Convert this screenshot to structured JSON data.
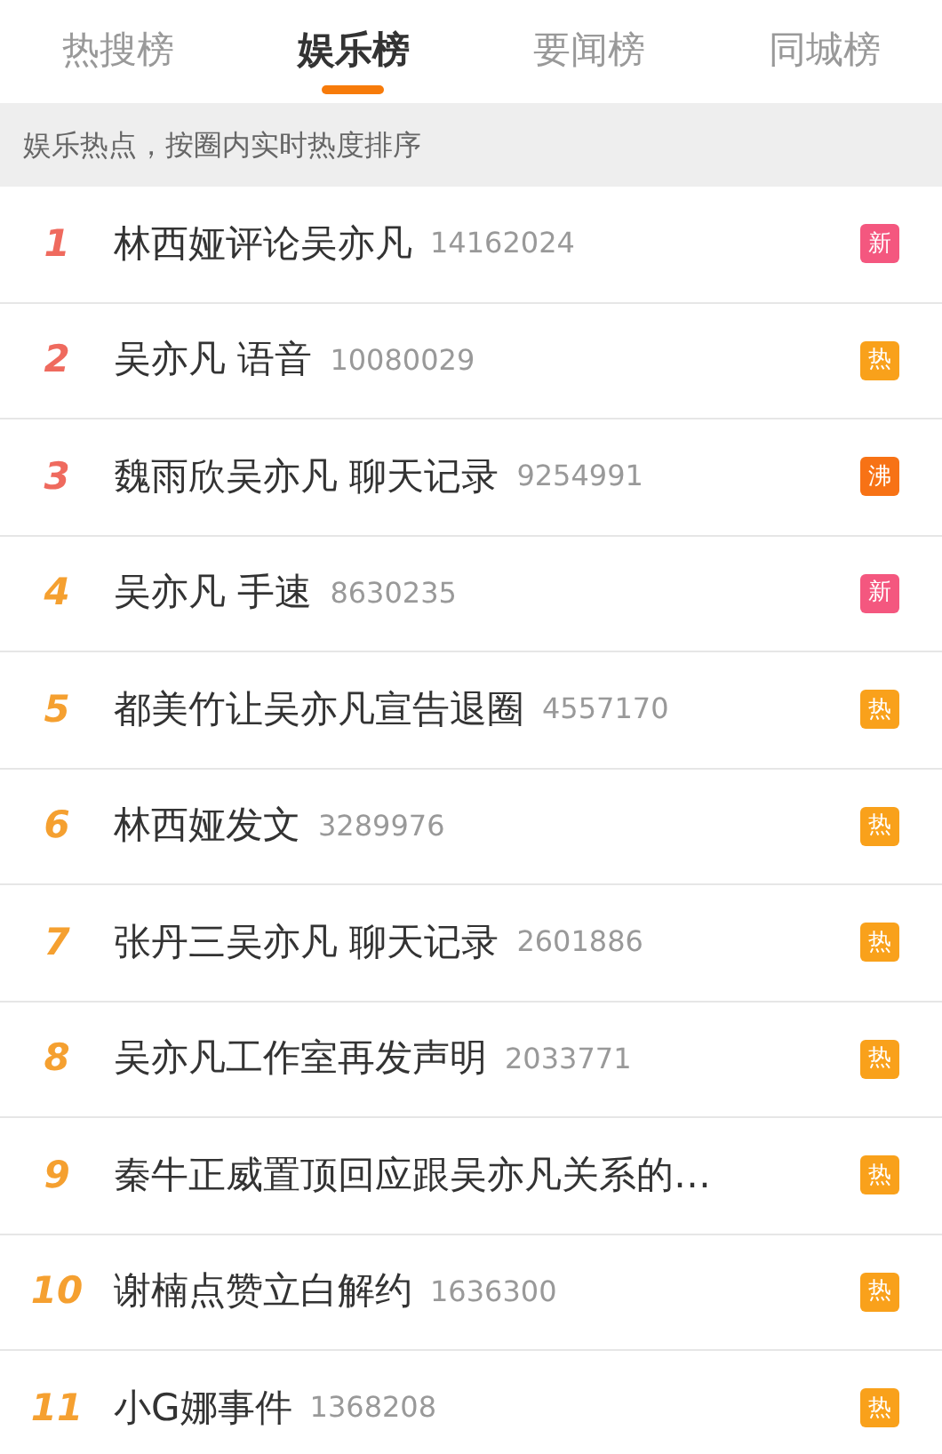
{
  "tabs": [
    {
      "label": "热搜榜",
      "selected": false
    },
    {
      "label": "娱乐榜",
      "selected": true
    },
    {
      "label": "要闻榜",
      "selected": false
    },
    {
      "label": "同城榜",
      "selected": false
    }
  ],
  "subtitle": "娱乐热点，按圈内实时热度排序",
  "items": [
    {
      "rank": "1",
      "color": "#ef6a5e",
      "title": "林西娅评论吴亦凡",
      "count": "14162024",
      "badge": {
        "kind": "new",
        "text": "新"
      }
    },
    {
      "rank": "2",
      "color": "#ef6a5e",
      "title": "吴亦凡 语音",
      "count": "10080029",
      "badge": {
        "kind": "hot",
        "text": "热"
      }
    },
    {
      "rank": "3",
      "color": "#ef6a5e",
      "title": "魏雨欣吴亦凡 聊天记录",
      "count": "9254991",
      "badge": {
        "kind": "boil",
        "text": "沸"
      }
    },
    {
      "rank": "4",
      "color": "#f5a030",
      "title": "吴亦凡 手速",
      "count": "8630235",
      "badge": {
        "kind": "new",
        "text": "新"
      }
    },
    {
      "rank": "5",
      "color": "#f5a030",
      "title": "都美竹让吴亦凡宣告退圈",
      "count": "4557170",
      "badge": {
        "kind": "hot",
        "text": "热"
      }
    },
    {
      "rank": "6",
      "color": "#f5a030",
      "title": "林西娅发文",
      "count": "3289976",
      "badge": {
        "kind": "hot",
        "text": "热"
      }
    },
    {
      "rank": "7",
      "color": "#f5a030",
      "title": "张丹三吴亦凡 聊天记录",
      "count": "2601886",
      "badge": {
        "kind": "hot",
        "text": "热"
      }
    },
    {
      "rank": "8",
      "color": "#f5a030",
      "title": "吴亦凡工作室再发声明",
      "count": "2033771",
      "badge": {
        "kind": "hot",
        "text": "热"
      }
    },
    {
      "rank": "9",
      "color": "#f5a030",
      "title": "秦牛正威置顶回应跟吴亦凡关系的…",
      "badge": {
        "kind": "hot",
        "text": "热"
      }
    },
    {
      "rank": "10",
      "color": "#f5a030",
      "title": "谢楠点赞立白解约",
      "count": "1636300",
      "badge": {
        "kind": "hot",
        "text": "热"
      }
    },
    {
      "rank": "11",
      "color": "#f5a030",
      "title": "小G娜事件",
      "count": "1368208",
      "badge": {
        "kind": "hot",
        "text": "热"
      }
    }
  ]
}
